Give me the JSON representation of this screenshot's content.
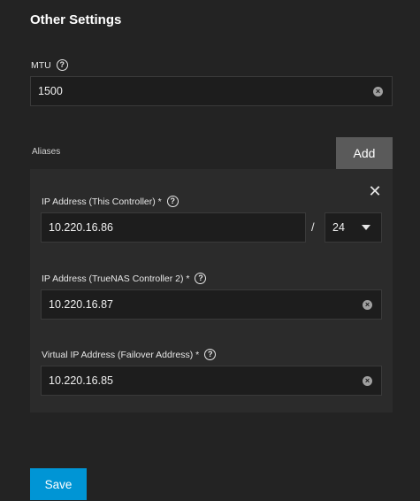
{
  "section": {
    "title": "Other Settings"
  },
  "mtu": {
    "label": "MTU",
    "value": "1500"
  },
  "aliases": {
    "label": "Aliases",
    "add_label": "Add",
    "close_glyph": "✕",
    "items": [
      {
        "controller_label": "IP Address (This Controller) *",
        "controller_value": "10.220.16.86",
        "netmask_separator": "/",
        "netmask_value": "24",
        "controller2_label": "IP Address (TrueNAS Controller 2) *",
        "controller2_value": "10.220.16.87",
        "virtual_label": "Virtual IP Address (Failover Address) *",
        "virtual_value": "10.220.16.85"
      }
    ]
  },
  "footer": {
    "save_label": "Save"
  },
  "icons": {
    "help": "?",
    "clear": "×"
  },
  "colors": {
    "background": "#232323",
    "card": "#2b2b2b",
    "primary": "#0095d5",
    "secondary_button": "#5a5a5a"
  }
}
